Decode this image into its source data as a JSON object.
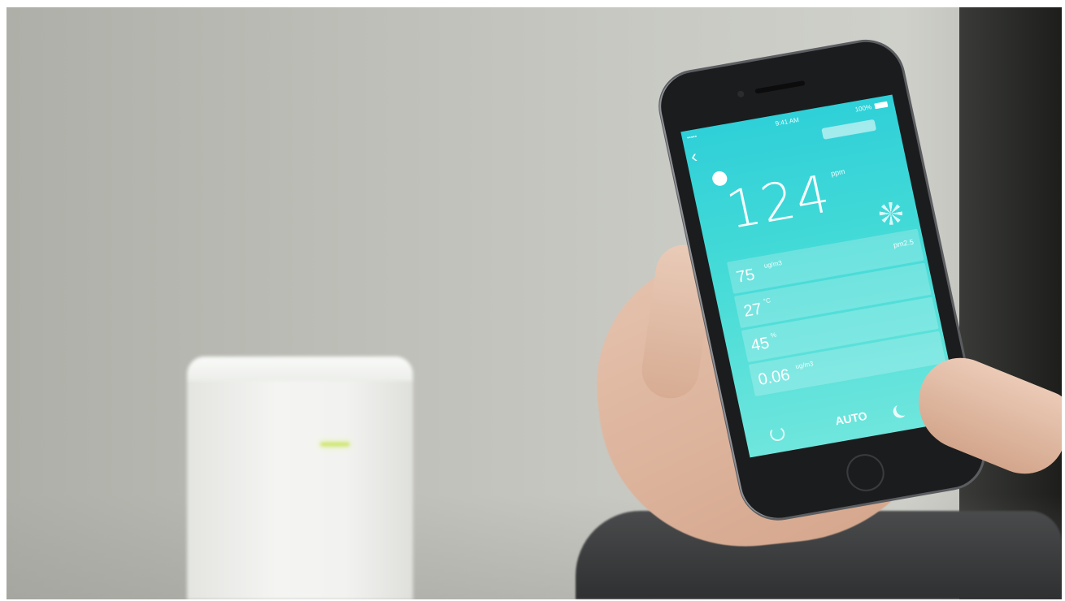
{
  "status_bar": {
    "signal": "•••••",
    "time": "9:41 AM",
    "battery": "100%"
  },
  "app": {
    "reading": {
      "value": "124",
      "unit": "ppm"
    },
    "metrics": [
      {
        "value": "75",
        "unit": "ug/m3",
        "tag": "pm2.5"
      },
      {
        "value": "27",
        "unit": "°C",
        "tag": ""
      },
      {
        "value": "45",
        "unit": "%",
        "tag": ""
      },
      {
        "value": "0.06",
        "unit": "ug/m3",
        "tag": ""
      }
    ],
    "mode_label": "AUTO"
  },
  "icons": [
    "back-icon",
    "fan-icon",
    "power-icon",
    "moon-icon",
    "menu-icon"
  ],
  "colors": {
    "screen_top": "#2fd0d8",
    "screen_bottom": "#6fe6dd",
    "led": "#c8e25a"
  }
}
